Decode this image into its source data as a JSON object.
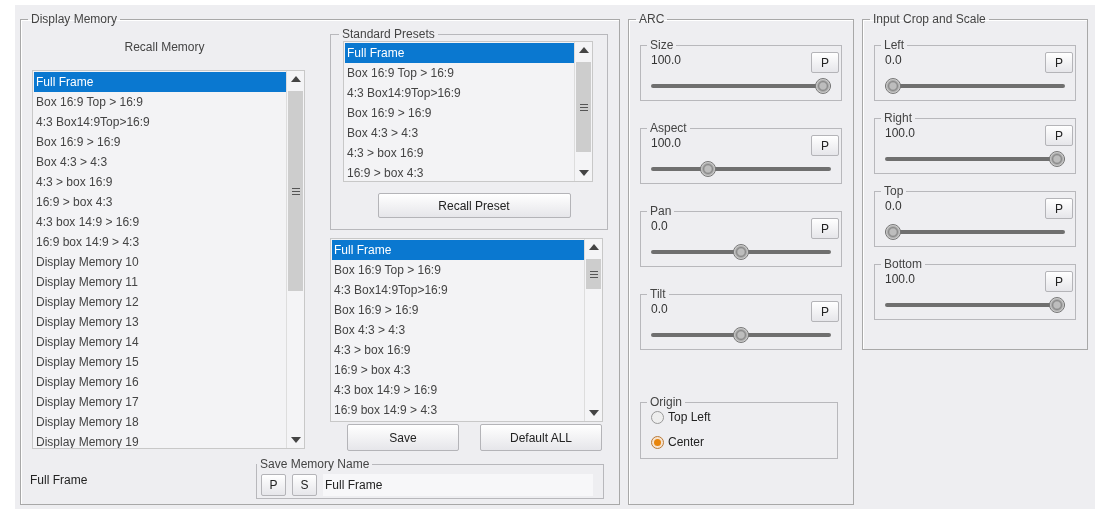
{
  "display_memory": {
    "title": "Display Memory",
    "recall_label": "Recall Memory",
    "recall_list": [
      {
        "label": "Full Frame",
        "selected": true
      },
      {
        "label": "Box 16:9 Top > 16:9",
        "selected": false
      },
      {
        "label": "4:3 Box14:9Top>16:9",
        "selected": false
      },
      {
        "label": "Box 16:9 > 16:9",
        "selected": false
      },
      {
        "label": "Box 4:3 > 4:3",
        "selected": false
      },
      {
        "label": "4:3 > box 16:9",
        "selected": false
      },
      {
        "label": "16:9 > box 4:3",
        "selected": false
      },
      {
        "label": "4:3 box 14:9 > 16:9",
        "selected": false
      },
      {
        "label": "16:9 box 14:9 > 4:3",
        "selected": false
      },
      {
        "label": "Display Memory 10",
        "selected": false
      },
      {
        "label": "Display Memory 11",
        "selected": false
      },
      {
        "label": "Display Memory 12",
        "selected": false
      },
      {
        "label": "Display Memory 13",
        "selected": false
      },
      {
        "label": "Display Memory 14",
        "selected": false
      },
      {
        "label": "Display Memory 15",
        "selected": false
      },
      {
        "label": "Display Memory 16",
        "selected": false
      },
      {
        "label": "Display Memory 17",
        "selected": false
      },
      {
        "label": "Display Memory 18",
        "selected": false
      },
      {
        "label": "Display Memory 19",
        "selected": false
      }
    ],
    "current_name": "Full Frame",
    "standard_presets": {
      "title": "Standard Presets",
      "items": [
        {
          "label": "Full Frame",
          "selected": true
        },
        {
          "label": "Box 16:9 Top > 16:9",
          "selected": false
        },
        {
          "label": "4:3 Box14:9Top>16:9",
          "selected": false
        },
        {
          "label": "Box 16:9 > 16:9",
          "selected": false
        },
        {
          "label": "Box 4:3 > 4:3",
          "selected": false
        },
        {
          "label": "4:3 > box 16:9",
          "selected": false
        },
        {
          "label": "16:9 > box 4:3",
          "selected": false
        }
      ],
      "button": "Recall Preset"
    },
    "memory_list": [
      {
        "label": "Full Frame",
        "selected": true
      },
      {
        "label": "Box 16:9 Top > 16:9",
        "selected": false
      },
      {
        "label": "4:3 Box14:9Top>16:9",
        "selected": false
      },
      {
        "label": "Box 16:9 > 16:9",
        "selected": false
      },
      {
        "label": "Box 4:3 > 4:3",
        "selected": false
      },
      {
        "label": "4:3 > box 16:9",
        "selected": false
      },
      {
        "label": "16:9 > box 4:3",
        "selected": false
      },
      {
        "label": "4:3 box 14:9 > 16:9",
        "selected": false
      },
      {
        "label": "16:9 box 14:9 > 4:3",
        "selected": false
      }
    ],
    "buttons": [
      "Save",
      "Default ALL"
    ],
    "save_name": {
      "title": "Save Memory Name",
      "buttons": [
        "P",
        "S"
      ],
      "value": "Full Frame"
    }
  },
  "arc": {
    "title": "ARC",
    "sliders": [
      {
        "label": "Size",
        "value": "100.0",
        "button": "P",
        "level": 1
      },
      {
        "label": "Aspect",
        "value": "100.0",
        "button": "P",
        "level": 0.3
      },
      {
        "label": "Pan",
        "value": "0.0",
        "button": "P",
        "level": 0.5
      },
      {
        "label": "Tilt",
        "value": "0.0",
        "button": "P",
        "level": 0.5
      }
    ],
    "origin": {
      "title": "Origin",
      "options": [
        {
          "label": "Top Left",
          "selected": false
        },
        {
          "label": "Center",
          "selected": true
        }
      ]
    }
  },
  "input_crop": {
    "title": "Input Crop and Scale",
    "sliders": [
      {
        "label": "Left",
        "value": "0.0",
        "button": "P",
        "level": 0
      },
      {
        "label": "Right",
        "value": "100.0",
        "button": "P",
        "level": 1
      },
      {
        "label": "Top",
        "value": "0.0",
        "button": "P",
        "level": 0
      },
      {
        "label": "Bottom",
        "value": "100.0",
        "button": "P",
        "level": 1
      }
    ]
  }
}
